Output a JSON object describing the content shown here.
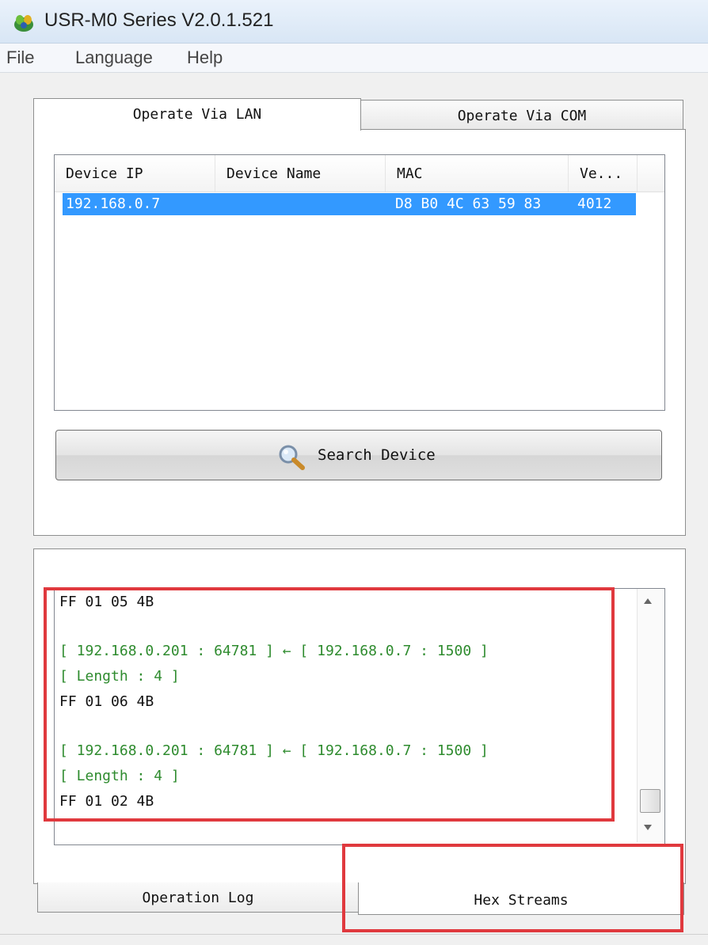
{
  "window": {
    "title": "USR-M0 Series V2.0.1.521"
  },
  "menu": [
    "File",
    "Language",
    "Help"
  ],
  "tabs_top": [
    {
      "label": "Operate Via LAN",
      "selected": true
    },
    {
      "label": "Operate Via COM",
      "selected": false
    }
  ],
  "device_list": {
    "columns": [
      "Device IP",
      "Device Name",
      "MAC",
      "Ve..."
    ],
    "rows": [
      {
        "ip": "192.168.0.7",
        "name": "",
        "mac": "D8 B0 4C 63 59 83",
        "version": "4012",
        "selected": true
      }
    ]
  },
  "search_button": {
    "label": "Search Device",
    "icon": "magnifier-icon"
  },
  "log_lines": [
    {
      "text": "FF 01 05 4B",
      "kind": "hex"
    },
    {
      "text": "[ 192.168.0.201 : 64781 ] ← [ 192.168.0.7 : 1500 ]",
      "kind": "meta"
    },
    {
      "text": "[ Length : 4 ]",
      "kind": "meta"
    },
    {
      "text": "FF 01 06 4B",
      "kind": "hex"
    },
    {
      "text": "[ 192.168.0.201 : 64781 ] ← [ 192.168.0.7 : 1500 ]",
      "kind": "meta"
    },
    {
      "text": "[ Length : 4 ]",
      "kind": "meta"
    },
    {
      "text": "FF 01 02 4B",
      "kind": "hex"
    }
  ],
  "tabs_bottom": [
    {
      "label": "Operation Log",
      "selected": false
    },
    {
      "label": "Hex Streams",
      "selected": true
    }
  ],
  "colors": {
    "selection": "#3399ff",
    "highlight_box": "#e0393e",
    "log_meta_text": "#2e8b2e"
  }
}
